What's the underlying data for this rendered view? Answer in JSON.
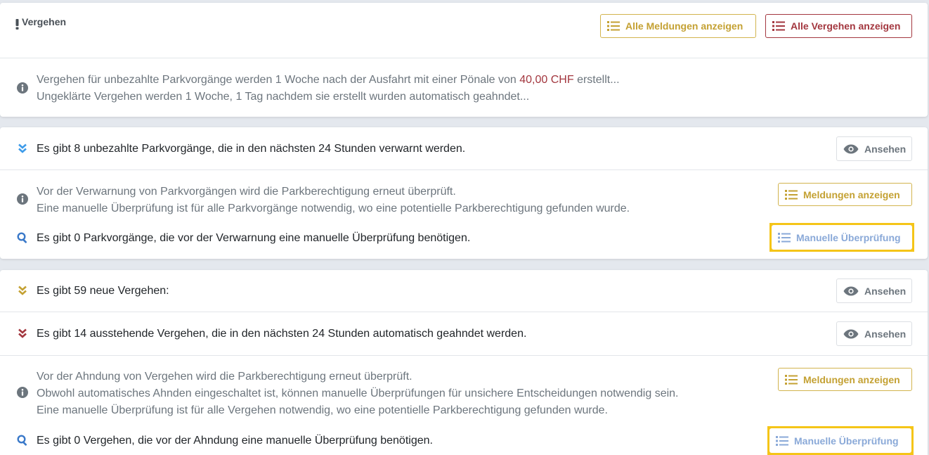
{
  "colors": {
    "gold": "#c4a133",
    "red": "#a3373f",
    "blue": "#8aa9d8",
    "info_gray": "#6c757d",
    "highlight": "#f5c518"
  },
  "section1": {
    "title": "Vergehen",
    "title_icon": "exclamation-icon",
    "btn_all_messages": "Alle Meldungen anzeigen",
    "btn_all_offenses": "Alle Vergehen anzeigen",
    "info_line1_pre": "Vergehen für unbezahlte Parkvorgänge werden 1 Woche nach der Ausfahrt mit einer Pönale von ",
    "info_line1_amount": "40,00 CHF",
    "info_line1_post": " erstellt...",
    "info_line2": "Ungeklärte Vergehen werden 1 Woche, 1 Tag nachdem sie erstellt wurden automatisch geahndet..."
  },
  "section2": {
    "unpaid_text": "Es gibt 8 unbezahlte Parkvorgänge, die in den nächsten 24 Stunden verwarnt werden.",
    "view_label": "Ansehen",
    "info_line1": "Vor der Verwarnung von Parkvorgängen wird die Parkberechtigung erneut überprüft.",
    "info_line2": "Eine manuelle Überprüfung ist für alle Parkvorgänge notwendig, wo eine potentielle Parkberechtigung gefunden wurde.",
    "messages_label": "Meldungen anzeigen",
    "review_text": "Es gibt 0 Parkvorgänge, die vor der Verwarnung eine manuelle Überprüfung benötigen.",
    "manual_review_label": "Manuelle Überprüfung"
  },
  "section3": {
    "new_text": "Es gibt 59 neue Vergehen:",
    "view_label_new": "Ansehen",
    "pending_text": "Es gibt 14 ausstehende Vergehen, die in den nächsten 24 Stunden automatisch geahndet werden.",
    "view_label_pending": "Ansehen",
    "info_line1": "Vor der Ahndung von Vergehen wird die Parkberechtigung erneut überprüft.",
    "info_line2": "Obwohl automatisches Ahnden eingeschaltet ist, können manuelle Überprüfungen für unsichere Entscheidungen notwendig sein.",
    "info_line3": "Eine manuelle Überprüfung ist für alle Vergehen notwendig, wo eine potentielle Parkberechtigung gefunden wurde.",
    "messages_label": "Meldungen anzeigen",
    "review_text": "Es gibt 0 Vergehen, die vor der Ahndung eine manuelle Überprüfung benötigen.",
    "manual_review_label": "Manuelle Überprüfung"
  }
}
